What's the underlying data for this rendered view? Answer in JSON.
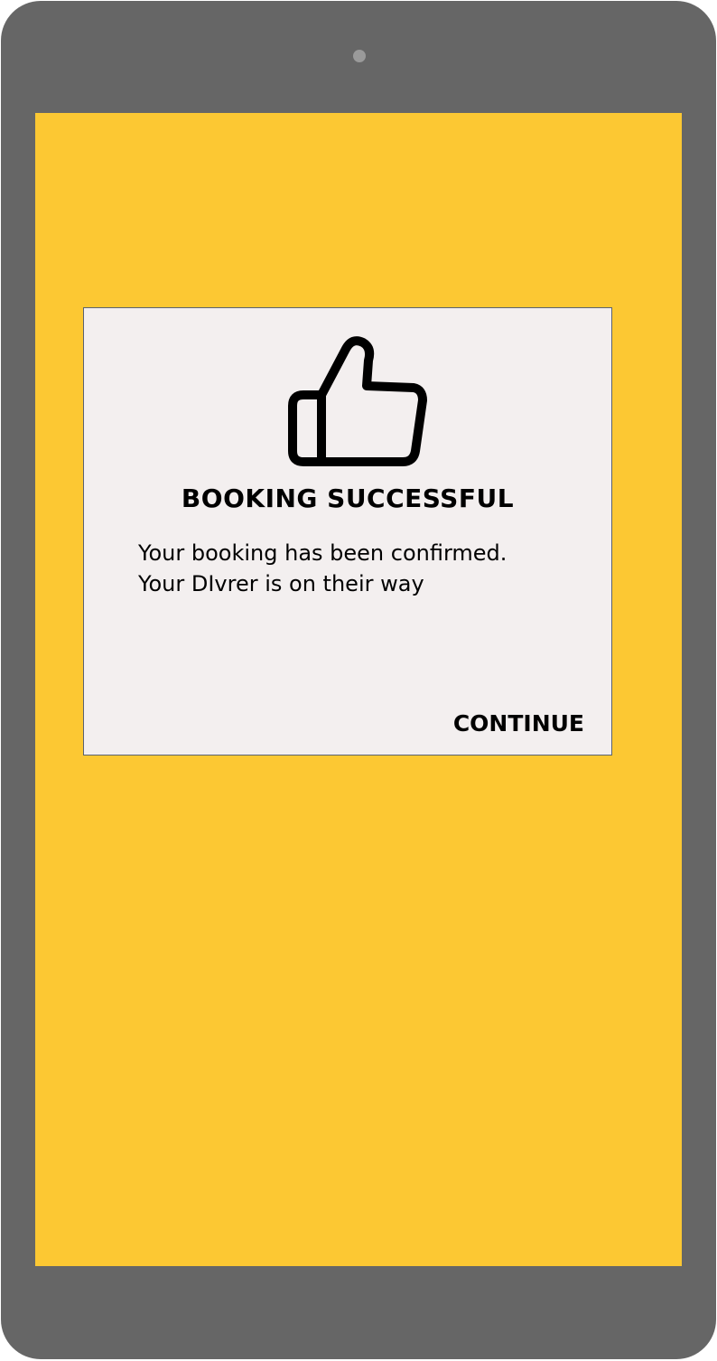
{
  "dialog": {
    "icon": "thumbs-up-icon",
    "title": "BOOKING SUCCESSFUL",
    "message_line1": "Your booking has been confirmed.",
    "message_line2": "Your DIvrer is on their way",
    "continue_label": "CONTINUE"
  },
  "colors": {
    "device_frame": "#666666",
    "screen_background": "#fcc833",
    "dialog_background": "#f3efef"
  }
}
